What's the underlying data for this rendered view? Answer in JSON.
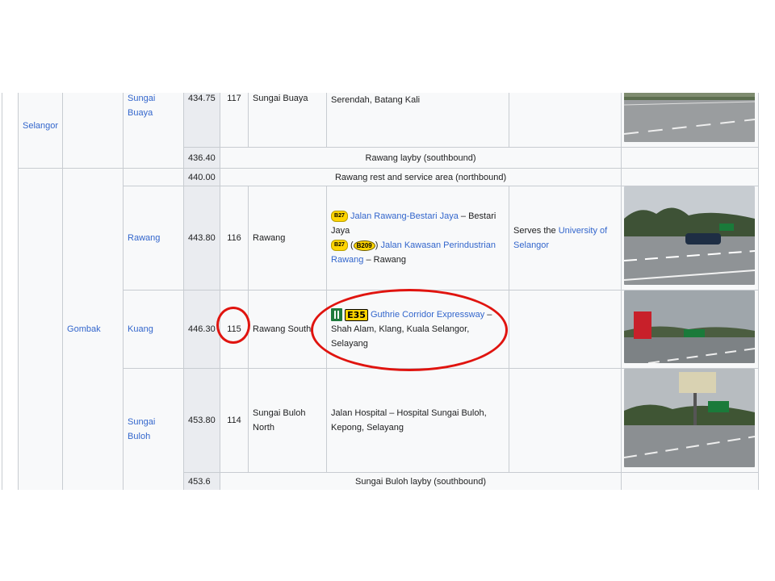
{
  "rows": {
    "sungai_buaya": {
      "location": "Sungai Buaya",
      "km": "434.75",
      "exit_no": "117",
      "interchange": "Sungai Buaya",
      "destinations": "Serendah, Batang Kali"
    },
    "rawang_layby": {
      "km": "436.40",
      "feature": "Rawang layby (southbound)"
    },
    "rawang_rsa": {
      "km": "440.00",
      "feature": "Rawang rest and service area (northbound)"
    },
    "rawang": {
      "location": "Rawang",
      "km": "443.80",
      "exit_no": "116",
      "interchange": "Rawang",
      "route1_badge": "B27",
      "route1_link": "Jalan Rawang-Bestari Jaya",
      "route1_suffix": " – Bestari Jaya",
      "route2_badge": "B27",
      "route2_badge_b": "B209",
      "route2_link": "Jalan Kawasan Perindustrian Rawang",
      "route2_suffix": " – Rawang",
      "notes_prefix": "Serves the ",
      "notes_link": "University of Selangor"
    },
    "kuang": {
      "location": "Kuang",
      "km": "446.30",
      "exit_no": "115",
      "interchange": "Rawang South",
      "badge": "E35",
      "link": "Guthrie Corridor Expressway",
      "suffix": " – Shah Alam, Klang, Kuala Selangor, Selayang"
    },
    "sungai_buloh": {
      "location": "Sungai Buloh",
      "km": "453.80",
      "exit_no": "114",
      "interchange": "Sungai Buloh North",
      "destinations": "Jalan Hospital – Hospital Sungai Buloh, Kepong, Selayang"
    },
    "sungai_buloh_layby": {
      "km": "453.6",
      "feature": "Sungai Buloh layby (southbound)"
    }
  },
  "state": "Selangor",
  "district": "Gombak",
  "colors": {
    "annotation": "#e0140f",
    "link": "#3366cc",
    "route_badge": "#ffd400",
    "expressway_sign": "#1d7a3c"
  }
}
